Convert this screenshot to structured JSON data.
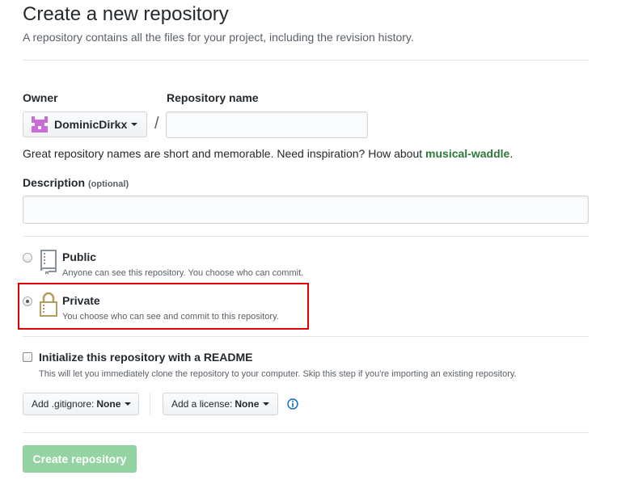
{
  "header": {
    "title": "Create a new repository",
    "subtitle": "A repository contains all the files for your project, including the revision history."
  },
  "owner": {
    "label": "Owner",
    "value": "DominicDirkx",
    "avatar_color": "#c86dd7"
  },
  "repo_name": {
    "label": "Repository name",
    "value": "",
    "separator": "/"
  },
  "hint": {
    "text": "Great repository names are short and memorable. Need inspiration? How about ",
    "suggestion": "musical-waddle",
    "end": "."
  },
  "description": {
    "label": "Description",
    "optional": "(optional)",
    "value": ""
  },
  "visibility": {
    "public": {
      "title": "Public",
      "desc": "Anyone can see this repository. You choose who can commit.",
      "checked": false
    },
    "private": {
      "title": "Private",
      "desc": "You choose who can see and commit to this repository.",
      "checked": true
    }
  },
  "readme": {
    "label": "Initialize this repository with a README",
    "desc": "This will let you immediately clone the repository to your computer. Skip this step if you're importing an existing repository.",
    "checked": false
  },
  "gitignore": {
    "label": "Add .gitignore:",
    "value": "None"
  },
  "license": {
    "label": "Add a license:",
    "value": "None"
  },
  "submit": {
    "label": "Create repository"
  },
  "colors": {
    "highlight": "#e00000",
    "button_green": "#94d3a2",
    "lock": "#b39d5f"
  }
}
